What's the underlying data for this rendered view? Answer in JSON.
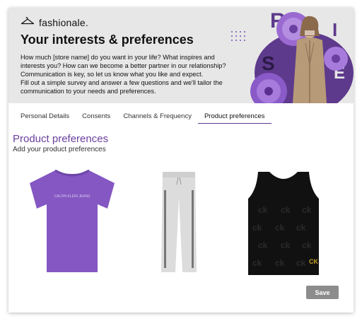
{
  "brand": {
    "name": "fashionale.",
    "icon": "hanger-icon"
  },
  "banner": {
    "title": "Your interests & preferences",
    "paragraphs": [
      "How much [store name] do you want in your life? What inspires and interests you? How can we become a better partner in our relationship? Communication is key, so let us know what you like and expect.",
      "Fill out a simple survey and answer a few questions and we'll tailor the communication to your needs and preferences."
    ],
    "art_letters": [
      "R",
      "I",
      "S",
      "E",
      "E"
    ]
  },
  "tabs": [
    {
      "label": "Personal Details",
      "active": false
    },
    {
      "label": "Consents",
      "active": false
    },
    {
      "label": "Channels & Frequency",
      "active": false
    },
    {
      "label": "Product preferences",
      "active": true
    }
  ],
  "section": {
    "title": "Product preferences",
    "subtitle": "Add your product preferences"
  },
  "products": [
    {
      "name": "purple-tshirt",
      "print": "CALVIN KLEIN JEANS"
    },
    {
      "name": "grey-joggers"
    },
    {
      "name": "black-crop-top",
      "print": "CK"
    }
  ],
  "actions": {
    "save_label": "Save"
  },
  "colors": {
    "accent": "#6a3f9e",
    "banner_bg": "#e7e7e7",
    "save_bg": "#8c8c8c"
  }
}
